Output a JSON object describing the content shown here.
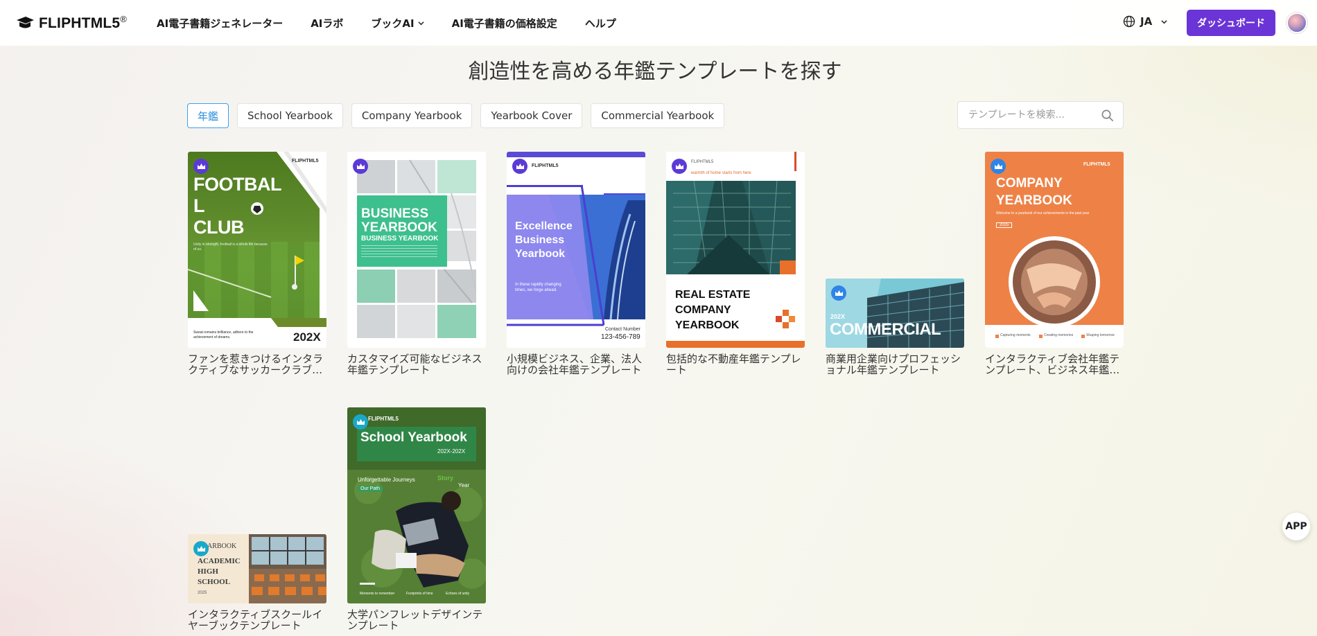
{
  "header": {
    "logo_text": "FLIPHTML5",
    "logo_reg": "®",
    "nav": [
      {
        "label": "AI電子書籍ジェネレーター"
      },
      {
        "label": "AIラボ"
      },
      {
        "label": "ブックAI"
      },
      {
        "label": "AI電子書籍の価格設定"
      },
      {
        "label": "ヘルプ"
      }
    ],
    "lang": "JA",
    "dashboard_label": "ダッシュボード"
  },
  "page_title": "創造性を高める年鑑テンプレートを探す",
  "filters": [
    {
      "label": "年鑑",
      "active": true
    },
    {
      "label": "School Yearbook"
    },
    {
      "label": "Company Yearbook"
    },
    {
      "label": "Yearbook Cover"
    },
    {
      "label": "Commercial Yearbook"
    }
  ],
  "search": {
    "placeholder": "テンプレートを検索..."
  },
  "templates": [
    {
      "caption": "ファンを惹きつけるインタラクティブなサッカークラブ年鑑テンプレート"
    },
    {
      "caption": "カスタマイズ可能なビジネス年鑑テンプレート"
    },
    {
      "caption": "小規模ビジネス、企業、法人向けの会社年鑑テンプレート"
    },
    {
      "caption": "包括的な不動産年鑑テンプレート"
    },
    {
      "caption": "商業用企業向けプロフェッショナル年鑑テンプレート"
    },
    {
      "caption": "インタラクティブ会社年鑑テンプレート、ビジネス年鑑テンプレート"
    },
    {
      "caption": "インタラクティブスクールイヤーブックテンプレート"
    },
    {
      "caption": "大学パンフレットデザインテンプレート"
    }
  ],
  "thumbs": {
    "football": {
      "title1": "FOOTBAL",
      "title2": "L",
      "title3": "CLUB",
      "brand": "FLIPHTML5",
      "sub": "Unity in strength, football is a whole life because of us.",
      "foot": "Sweat remains brilliance, adhere to the achievement of dreams.",
      "year": "202X"
    },
    "business": {
      "title1": "BUSINESS",
      "title2": "YEARBOOK",
      "sub": "BUSINESS YEARBOOK"
    },
    "excellence": {
      "brand": "FLIPHTML5",
      "title1": "Excellence",
      "title2": "Business",
      "title3": "Yearbook",
      "sub": "In these rapidly changing times, we forge ahead.",
      "contact": "Contact Number",
      "phone": "123-456-789"
    },
    "realestate": {
      "brand": "FLIPHTML5",
      "tag": "warmth of home starts from here",
      "title1": "REAL ESTATE",
      "title2": "COMPANY",
      "title3": "YEARBOOK"
    },
    "commercial": {
      "year": "202X",
      "title": "COMMERCIAL"
    },
    "company": {
      "brand": "FLIPHTML5",
      "title1": "COMPANY",
      "title2": "YEARBOOK",
      "sub": "Welcome to a yearbook of our achievements in the past year",
      "year": "2025",
      "f1": "Capturing moments",
      "f2": "Creating memories",
      "f3": "Shaping tomorrow"
    },
    "academic": {
      "top": "ARBOOK",
      "title1": "ACADEMIC",
      "title2": "HIGH",
      "title3": "SCHOOL",
      "year": "2025"
    },
    "school": {
      "brand": "FLIPHTML5",
      "title": "School Yearbook",
      "years": "202X-202X",
      "sub": "Unforgettable Journeys",
      "path": "Our Path",
      "story": "Story",
      "year": "Year",
      "f1": "Moments to remember",
      "f2": "Footprints of time",
      "f3": "Echoes of unity"
    }
  },
  "app_label": "APP"
}
